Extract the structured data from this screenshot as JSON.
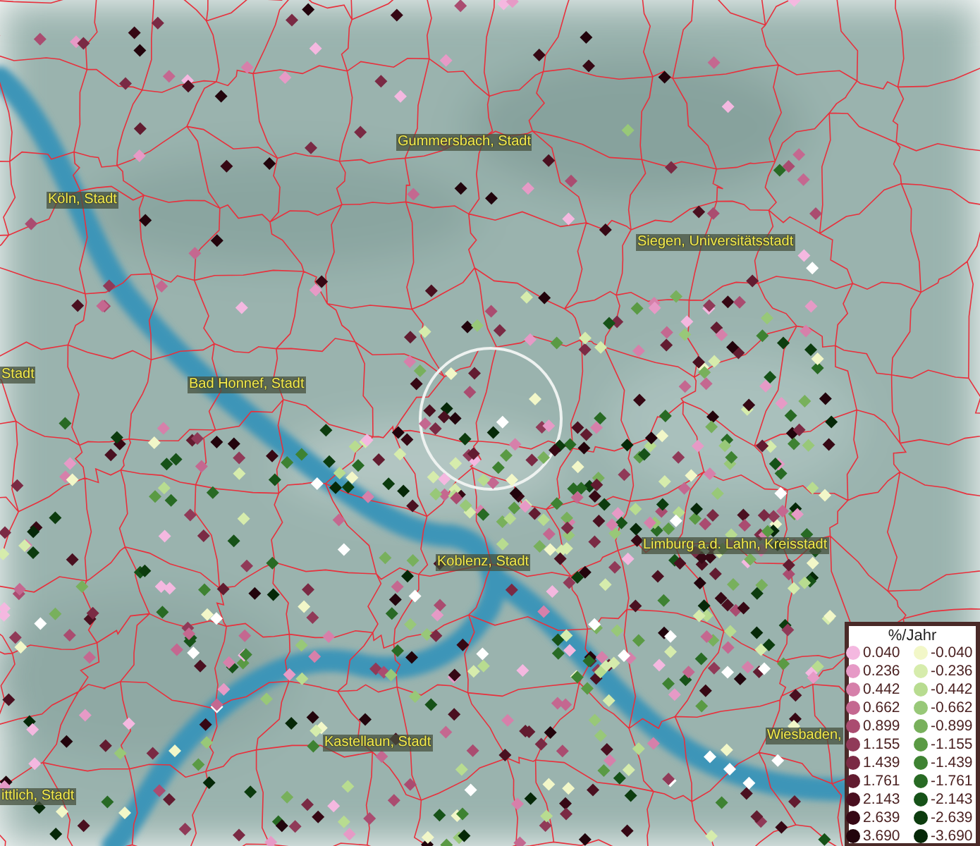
{
  "map": {
    "place_labels": [
      {
        "text": "Gummersbach, Stadt"
      },
      {
        "text": "Köln, Stadt"
      },
      {
        "text": "Siegen, Universitätsstadt"
      },
      {
        "text": "Stadt"
      },
      {
        "text": "Bad Honnef, Stadt"
      },
      {
        "text": "Limburg a.d. Lahn, Kreisstadt"
      },
      {
        "text": "Koblenz, Stadt"
      },
      {
        "text": "Kastellaun, Stadt"
      },
      {
        "text": "Wiesbaden,"
      },
      {
        "text": "ittlich, Stadt"
      }
    ]
  },
  "legend": {
    "title": "%/Jahr",
    "rows": [
      {
        "positive": {
          "value": "0.040",
          "color": "#f4b8e0"
        },
        "negative": {
          "value": "-0.040",
          "color": "#f2f7c8"
        }
      },
      {
        "positive": {
          "value": "0.236",
          "color": "#e69ac6"
        },
        "negative": {
          "value": "-0.236",
          "color": "#d6ecac"
        }
      },
      {
        "positive": {
          "value": "0.442",
          "color": "#d680aa"
        },
        "negative": {
          "value": "-0.442",
          "color": "#b8dc90"
        }
      },
      {
        "positive": {
          "value": "0.662",
          "color": "#c46890"
        },
        "negative": {
          "value": "-0.662",
          "color": "#98c878"
        }
      },
      {
        "positive": {
          "value": "0.899",
          "color": "#aa4c70"
        },
        "negative": {
          "value": "-0.899",
          "color": "#78b05c"
        }
      },
      {
        "positive": {
          "value": "1.155",
          "color": "#903a58"
        },
        "negative": {
          "value": "-1.155",
          "color": "#5a9a44"
        }
      },
      {
        "positive": {
          "value": "1.439",
          "color": "#7a2a44"
        },
        "negative": {
          "value": "-1.439",
          "color": "#3e8232"
        }
      },
      {
        "positive": {
          "value": "1.761",
          "color": "#621c30"
        },
        "negative": {
          "value": "-1.761",
          "color": "#286a24"
        }
      },
      {
        "positive": {
          "value": "2.143",
          "color": "#4a1020"
        },
        "negative": {
          "value": "-2.143",
          "color": "#165218"
        }
      },
      {
        "positive": {
          "value": "2.639",
          "color": "#360814"
        },
        "negative": {
          "value": "-2.639",
          "color": "#0c3c0e"
        }
      },
      {
        "positive": {
          "value": "3.690",
          "color": "#22040c"
        },
        "negative": {
          "value": "-3.690",
          "color": "#062808"
        }
      }
    ]
  }
}
